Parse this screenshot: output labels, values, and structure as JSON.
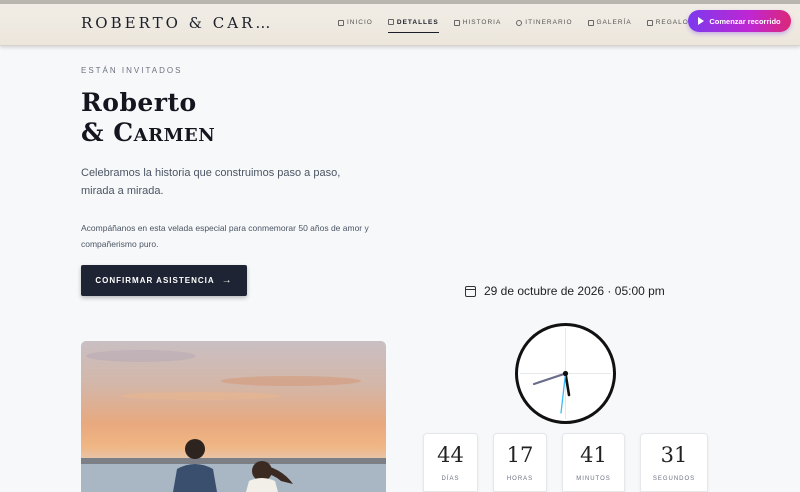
{
  "header": {
    "brand": "ROBERTO & CAR…",
    "nav": [
      {
        "label": "INICIO",
        "icon": "home-icon"
      },
      {
        "label": "DETALLES",
        "icon": "person-icon",
        "active": true
      },
      {
        "label": "HISTORIA",
        "icon": "book-icon"
      },
      {
        "label": "ITINERARIO",
        "icon": "clock-icon"
      },
      {
        "label": "GALERÍA",
        "icon": "image-icon"
      },
      {
        "label": "REGALOS",
        "icon": "gift-icon"
      }
    ],
    "cta": "Comenzar recorrido"
  },
  "hero": {
    "eyebrow": "ESTÁN INVITADOS",
    "title_line1": "Roberto",
    "title_line2": "& Carmen",
    "subtitle": "Celebramos la historia que construimos paso a paso, mirada a mirada.",
    "body": "Acompáñanos en esta velada especial para conmemorar 50 años de amor y compañerismo puro.",
    "confirm": "CONFIRMAR ASISTENCIA"
  },
  "event": {
    "date": "29 de octubre de 2026 · 05:00 pm"
  },
  "countdown": [
    {
      "value": "44",
      "label": "DÍAS"
    },
    {
      "value": "17",
      "label": "HORAS"
    },
    {
      "value": "41",
      "label": "MINUTOS"
    },
    {
      "value": "31",
      "label": "SEGUNDOS"
    }
  ],
  "colors": {
    "cta_gradient_start": "#7c3aed",
    "cta_gradient_end": "#db2777",
    "confirm_bg": "#1e2433"
  }
}
